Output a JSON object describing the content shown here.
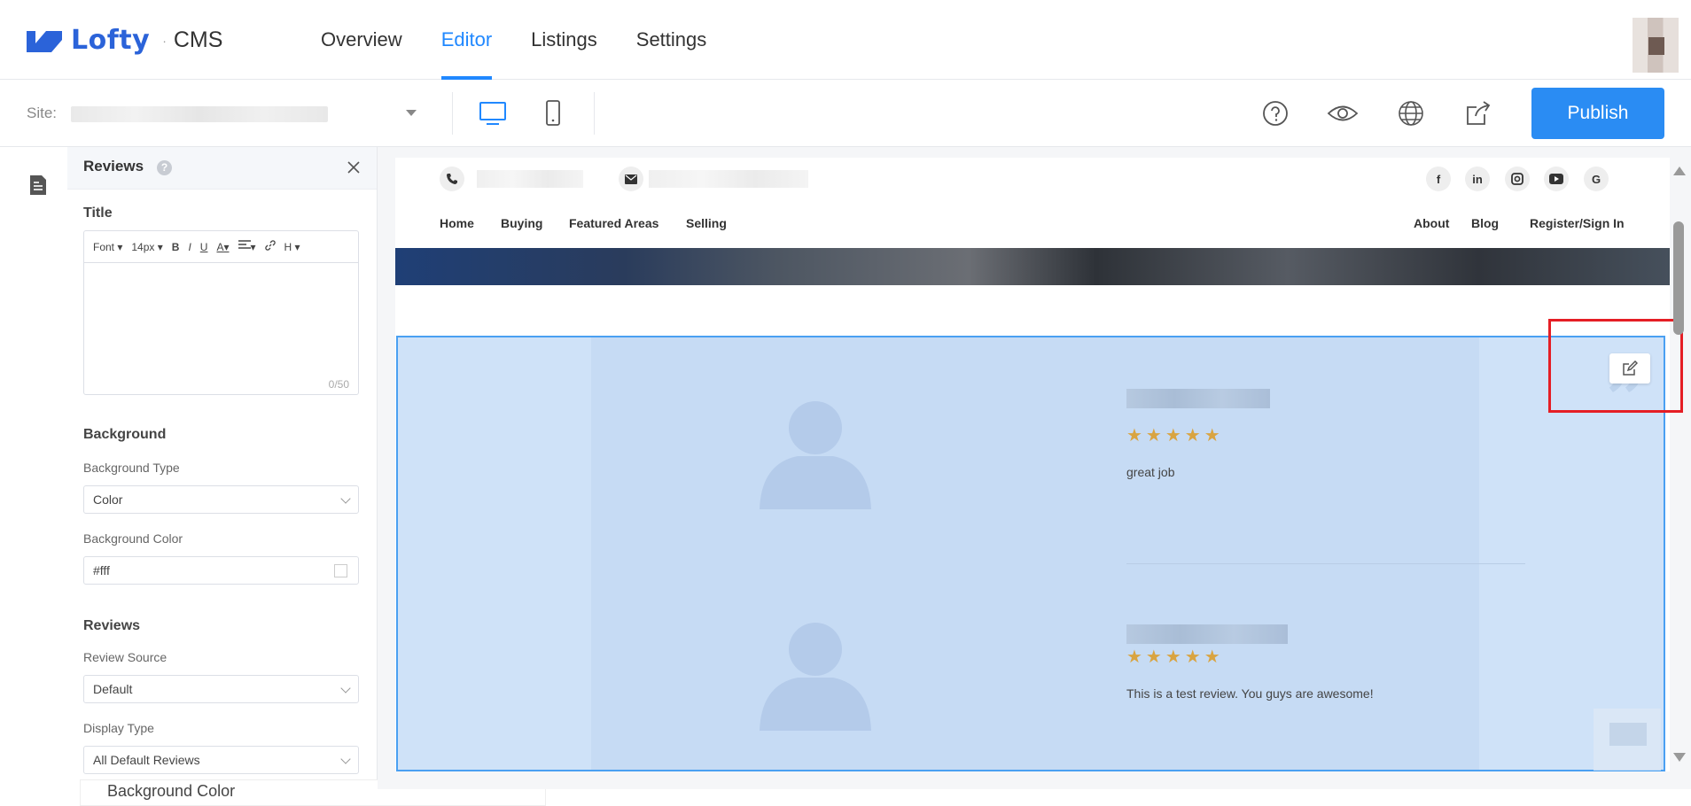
{
  "app": {
    "logo_text": "Lofty",
    "separator": "·",
    "product": "CMS"
  },
  "nav": {
    "items": [
      {
        "label": "Overview"
      },
      {
        "label": "Editor"
      },
      {
        "label": "Listings"
      },
      {
        "label": "Settings"
      }
    ],
    "active": "Editor"
  },
  "toolbar": {
    "site_label": "Site:",
    "publish_label": "Publish"
  },
  "panel": {
    "title": "Reviews",
    "help": "?",
    "title_section": "Title",
    "editor": {
      "font": "Font",
      "size": "14px",
      "bold": "B",
      "italic": "I",
      "underline": "U",
      "color": "A",
      "heading": "H",
      "count": "0/50"
    },
    "background_section": "Background",
    "background_type_label": "Background Type",
    "background_type_value": "Color",
    "background_color_label": "Background Color",
    "background_color_value": "#fff",
    "reviews_section": "Reviews",
    "review_source_label": "Review Source",
    "review_source_value": "Default",
    "display_type_label": "Display Type",
    "display_type_value": "All Default Reviews",
    "overflow_tip": "Background Color"
  },
  "site_preview": {
    "nav_left": [
      "Home",
      "Buying",
      "Featured Areas",
      "Selling"
    ],
    "nav_right": [
      "About",
      "Blog",
      "Register/Sign In"
    ],
    "social": [
      "f",
      "in",
      "ig",
      "yt",
      "G"
    ],
    "reviews": [
      {
        "stars": "★★★★★",
        "text": "great job"
      },
      {
        "stars": "★★★★★",
        "text": "This is a test review. You guys are awesome!"
      }
    ],
    "quote_mark": "”"
  },
  "colors": {
    "accent": "#2088ff",
    "publish": "#2a8cf3",
    "selection": "#cfe2f8",
    "highlight": "#e51e25",
    "star": "#d9a441"
  }
}
